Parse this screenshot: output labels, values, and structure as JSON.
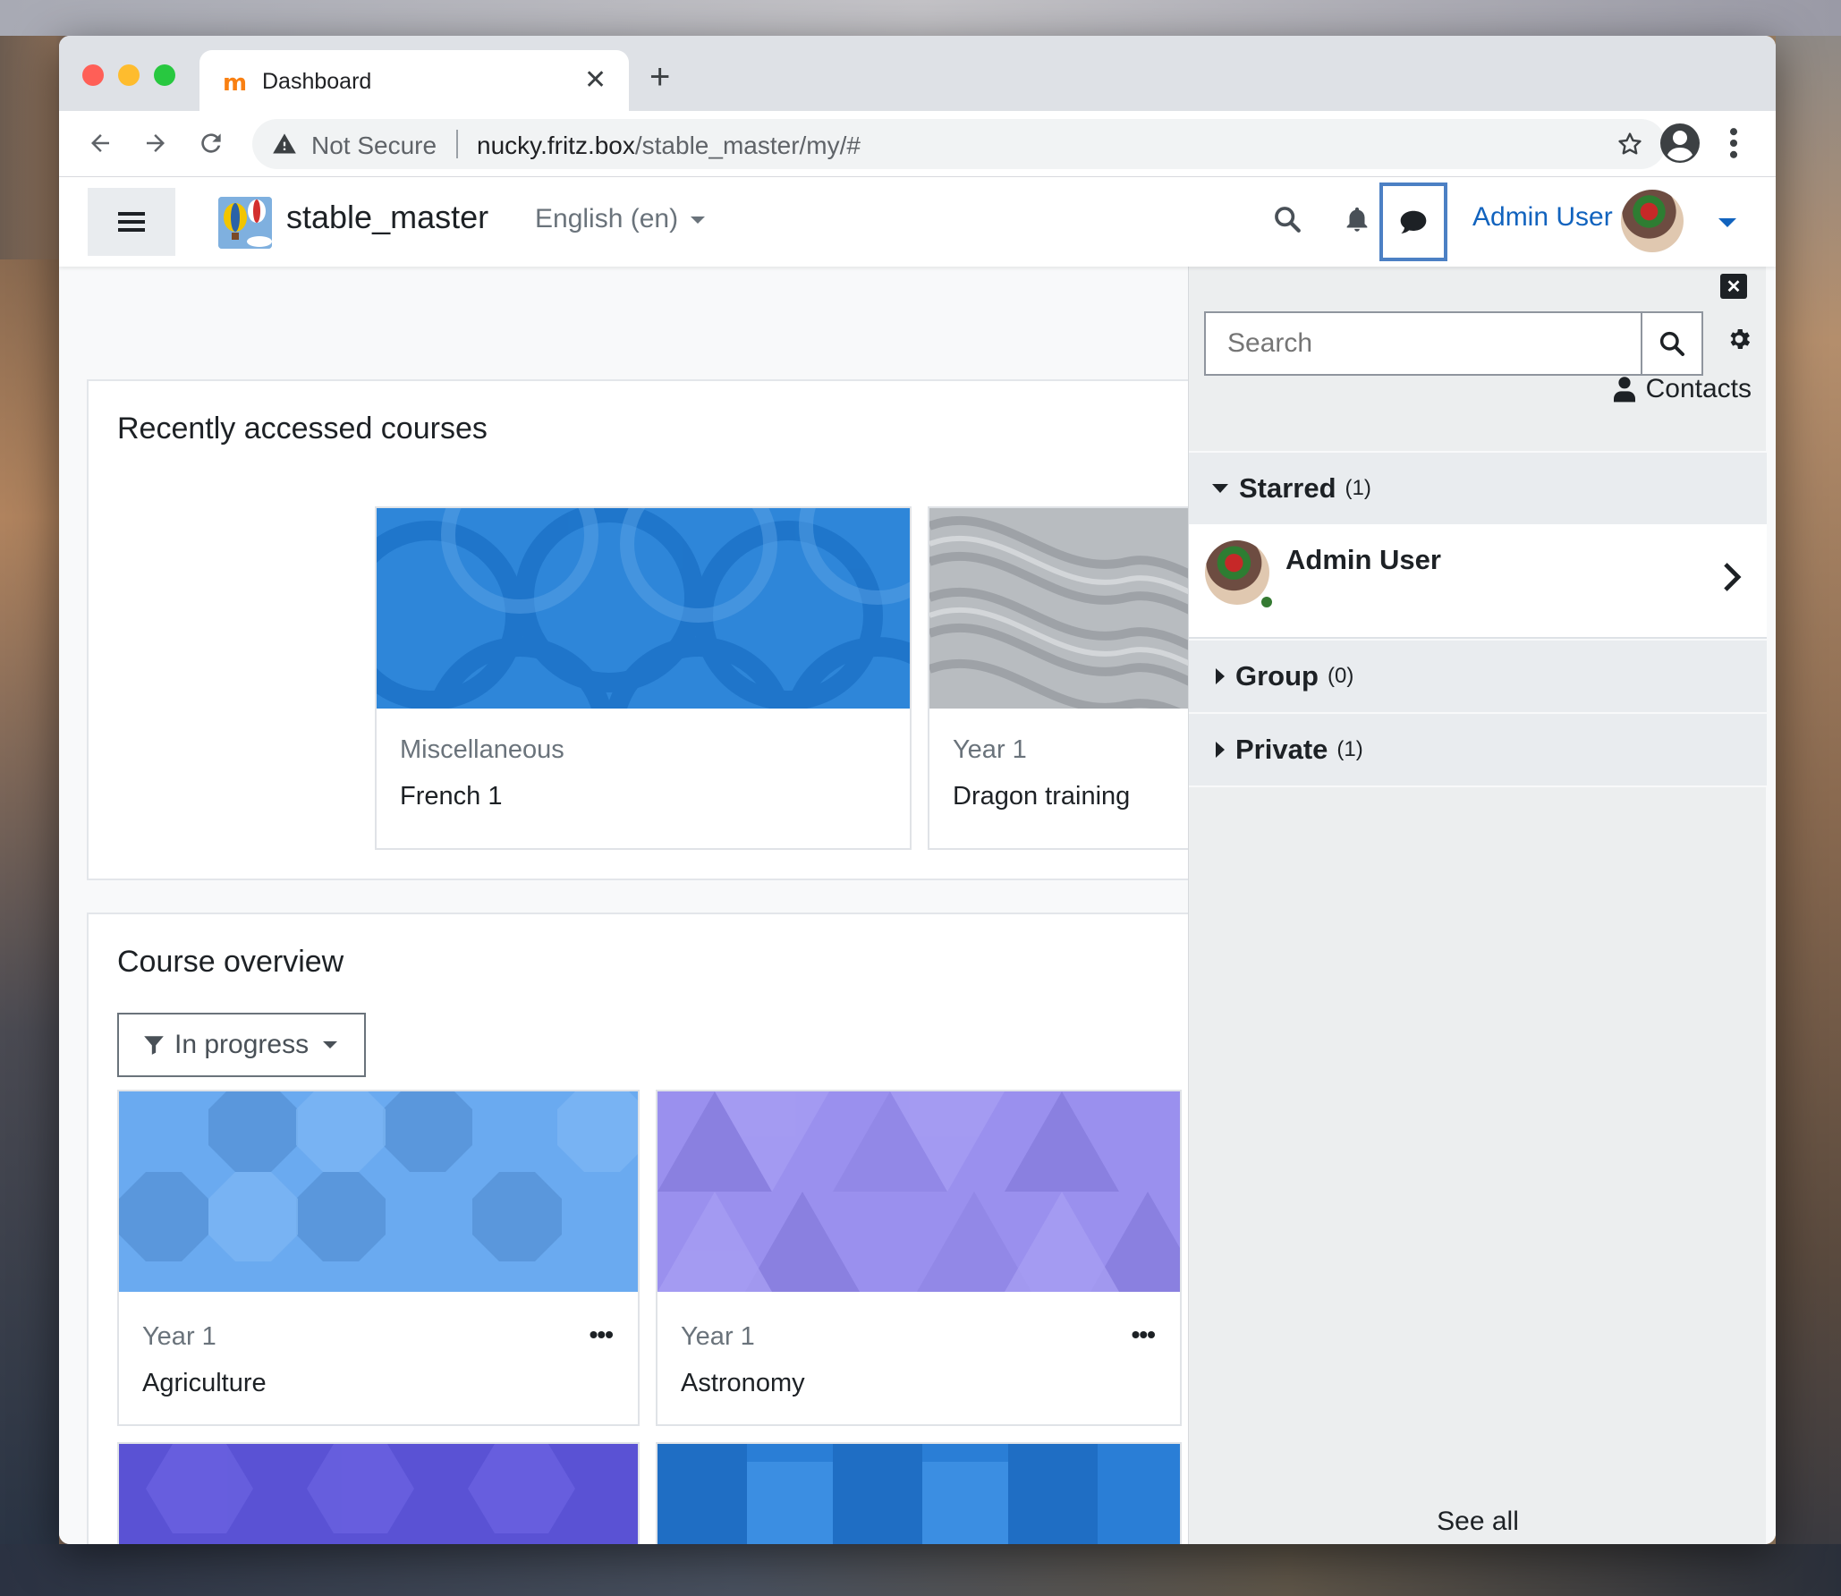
{
  "browser": {
    "tab_title": "Dashboard",
    "tab_favicon": "m",
    "security_label": "Not Secure",
    "url_host": "nucky.fritz.box",
    "url_path": "/stable_master/my/#",
    "traffic_lights": [
      "#ff5f57",
      "#febc2e",
      "#28c840"
    ]
  },
  "navbar": {
    "site_name": "stable_master",
    "language": "English (en)",
    "user_name": "Admin User",
    "accent": "#1163be",
    "active_outline": "#4c80c4"
  },
  "recent": {
    "title": "Recently accessed courses",
    "courses": [
      {
        "category": "Miscellaneous",
        "name": "French 1"
      },
      {
        "category": "Year 1",
        "name": "Dragon training"
      }
    ]
  },
  "overview": {
    "title": "Course overview",
    "filter": "In progress",
    "courses": [
      {
        "category": "Year 1",
        "name": "Agriculture",
        "more": "•••"
      },
      {
        "category": "Year 1",
        "name": "Astronomy",
        "more": "•••"
      }
    ]
  },
  "drawer": {
    "search_placeholder": "Search",
    "contacts_label": "Contacts",
    "sections": [
      {
        "label": "Starred",
        "count": "(1)",
        "expanded": true
      },
      {
        "label": "Group",
        "count": "(0)",
        "expanded": false
      },
      {
        "label": "Private",
        "count": "(1)",
        "expanded": false
      }
    ],
    "starred_contact": {
      "name": "Admin User",
      "status": "online"
    },
    "see_all": "See all",
    "icons": [
      "close-icon",
      "search-icon",
      "gear-icon",
      "user-icon",
      "chevron-right-icon"
    ]
  }
}
